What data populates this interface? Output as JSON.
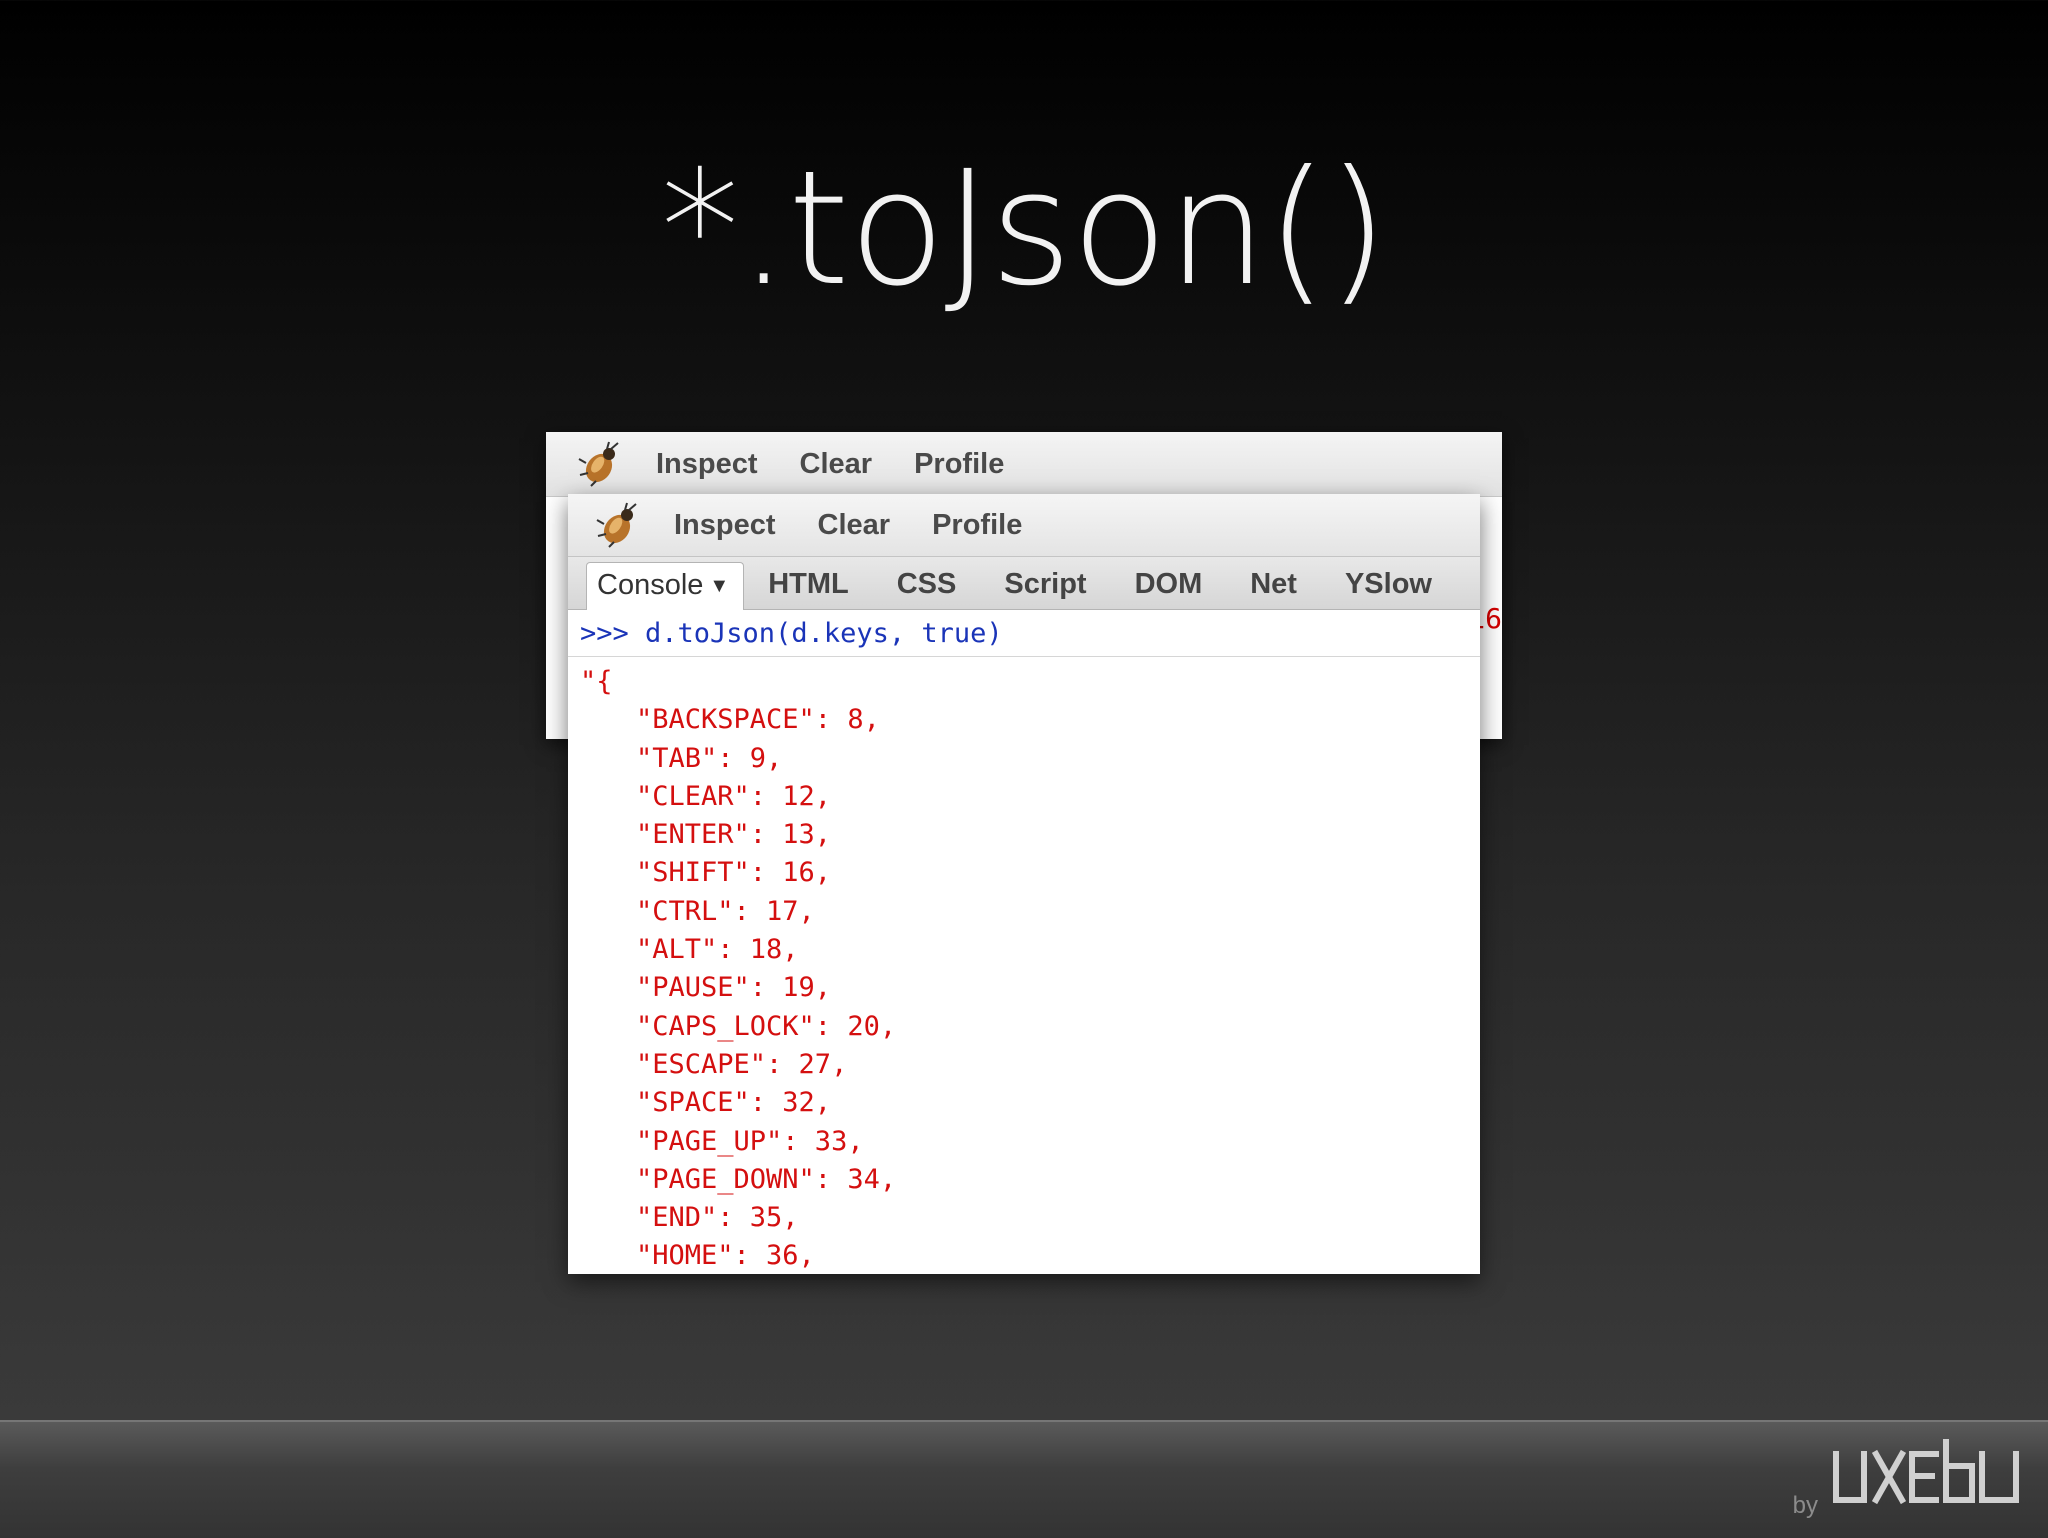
{
  "slide": {
    "title": "*.toJson()"
  },
  "back_window": {
    "toolbar": {
      "inspect": "Inspect",
      "clear": "Clear",
      "profile": "Profile"
    },
    "partial_text": "16"
  },
  "front_window": {
    "toolbar": {
      "inspect": "Inspect",
      "clear": "Clear",
      "profile": "Profile"
    },
    "tabs": {
      "console": "Console",
      "html": "HTML",
      "css": "CSS",
      "script": "Script",
      "dom": "DOM",
      "net": "Net",
      "yslow": "YSlow"
    },
    "active_tab": "Console",
    "command": ">>> d.toJson(d.keys, true)",
    "output_lines": [
      "\"{",
      "\"BACKSPACE\": 8,",
      "\"TAB\": 9,",
      "\"CLEAR\": 12,",
      "\"ENTER\": 13,",
      "\"SHIFT\": 16,",
      "\"CTRL\": 17,",
      "\"ALT\": 18,",
      "\"PAUSE\": 19,",
      "\"CAPS_LOCK\": 20,",
      "\"ESCAPE\": 27,",
      "\"SPACE\": 32,",
      "\"PAGE_UP\": 33,",
      "\"PAGE_DOWN\": 34,",
      "\"END\": 35,",
      "\"HOME\": 36,"
    ]
  },
  "footer": {
    "by": "by",
    "logo_text": "uxebu"
  },
  "colors": {
    "command": "#1a34b8",
    "output": "#d40f0f",
    "title": "#f2f2f2"
  }
}
